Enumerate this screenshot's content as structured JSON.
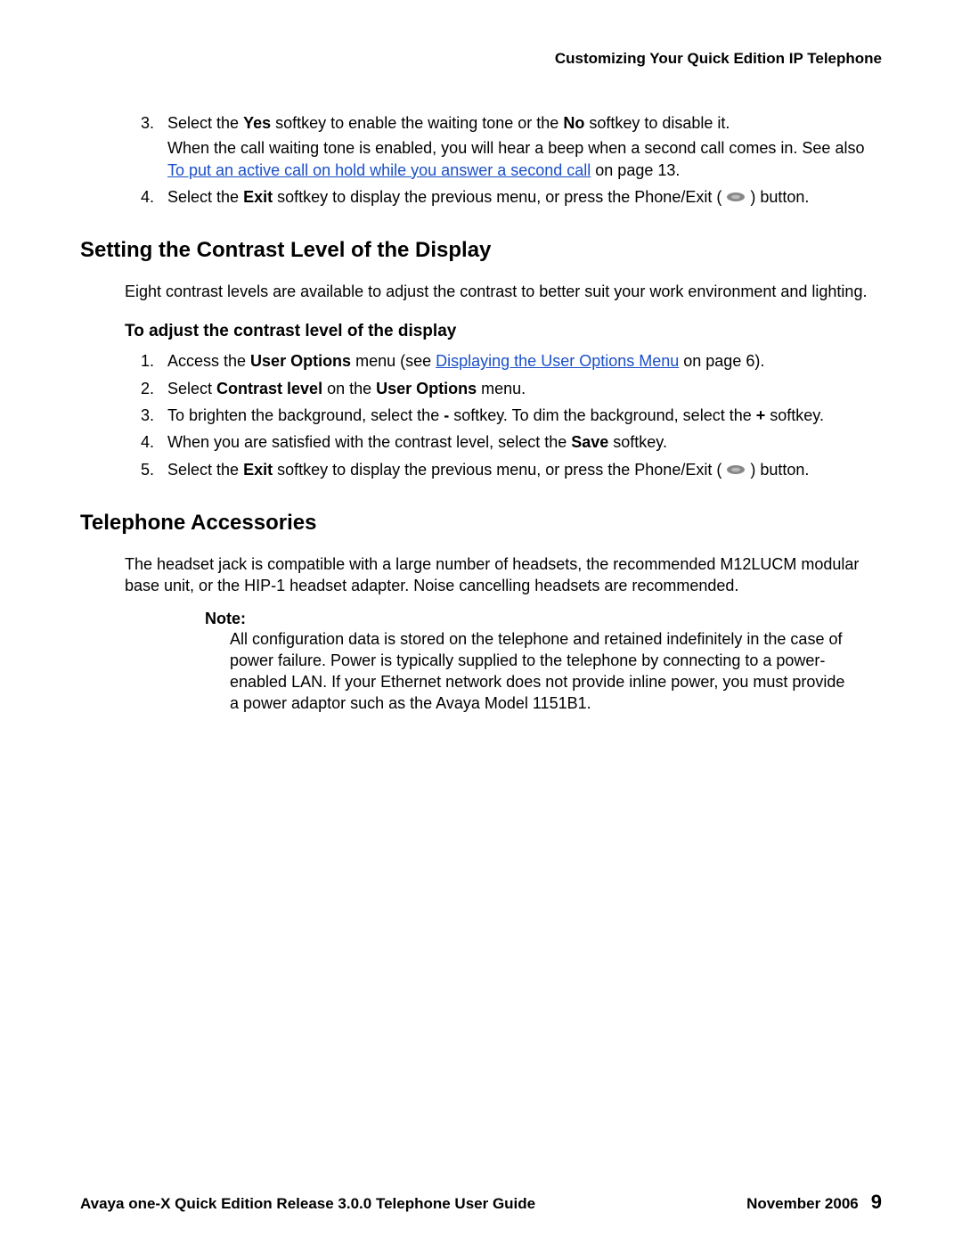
{
  "header": {
    "title": "Customizing Your Quick Edition IP Telephone"
  },
  "topList": {
    "item3": {
      "marker": "3.",
      "t1": "Select the ",
      "b1": "Yes",
      "t2": " softkey to enable the waiting tone or the ",
      "b2": "No",
      "t3": " softkey to disable it.",
      "para2_a": "When the call waiting tone is enabled, you will hear a beep when a second call comes in. See also ",
      "para2_link": "To put an active call on hold while you answer a second call",
      "para2_b": " on page 13."
    },
    "item4": {
      "marker": "4.",
      "t1": "Select the ",
      "b1": "Exit",
      "t2": " softkey to display the previous menu, or press the Phone/Exit ( ",
      "t3": " ) button."
    }
  },
  "contrast": {
    "heading": "Setting the Contrast Level of the Display",
    "intro": "Eight contrast levels are available to adjust the contrast to better suit your work environment and lighting.",
    "subheading": "To adjust the contrast level of the display",
    "s1": {
      "marker": "1.",
      "t1": "Access the ",
      "b1": "User Options",
      "t2": " menu (see ",
      "link": "Displaying the User Options Menu",
      "t3": " on page 6)."
    },
    "s2": {
      "marker": "2.",
      "t1": "Select ",
      "b1": "Contrast level",
      "t2": " on the ",
      "b2": "User Options",
      "t3": " menu."
    },
    "s3": {
      "marker": "3.",
      "t1": "To brighten the background, select the ",
      "b1": "-",
      "t2": " softkey. To dim the background, select the ",
      "b2": "+",
      "t3": " softkey."
    },
    "s4": {
      "marker": "4.",
      "t1": "When you are satisfied with the contrast level, select the ",
      "b1": "Save",
      "t2": " softkey."
    },
    "s5": {
      "marker": "5.",
      "t1": "Select the ",
      "b1": "Exit",
      "t2": " softkey to display the previous menu, or press the Phone/Exit ( ",
      "t3": " ) button."
    }
  },
  "accessories": {
    "heading": "Telephone Accessories",
    "intro": "The headset jack is compatible with a large number of headsets, the recommended M12LUCM modular base unit, or the HIP-1 headset adapter. Noise cancelling headsets are recommended.",
    "noteLabel": "Note:",
    "noteText": "All configuration data is stored on the telephone and retained indefinitely in the case of power failure. Power is typically supplied to the telephone by connecting to a power-enabled LAN. If your Ethernet network does not provide inline power, you must provide a power adaptor such as the Avaya Model 1151B1."
  },
  "footer": {
    "left": "Avaya one-X Quick Edition Release 3.0.0 Telephone User Guide",
    "date": "November 2006",
    "page": "9"
  }
}
